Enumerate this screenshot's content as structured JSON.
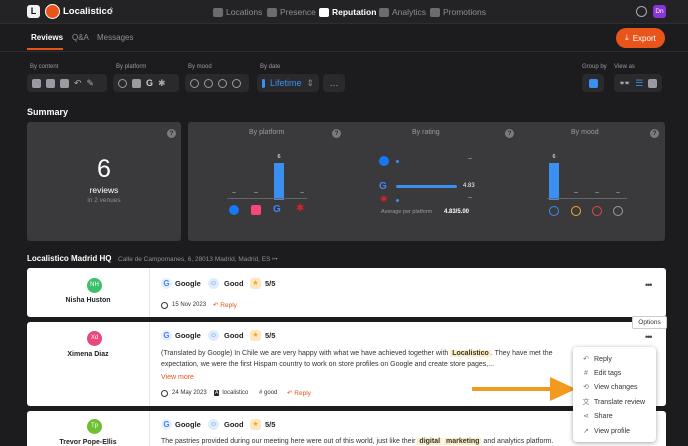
{
  "topbar": {
    "logo_letter": "L",
    "brand": "Localistico",
    "nav": [
      {
        "label": "Locations",
        "icon": "locations-icon"
      },
      {
        "label": "Presence",
        "icon": "presence-icon"
      },
      {
        "label": "Reputation",
        "icon": "reputation-icon"
      },
      {
        "label": "Analytics",
        "icon": "analytics-icon"
      },
      {
        "label": "Promotions",
        "icon": "promotions-icon"
      }
    ],
    "avatar": "Dn"
  },
  "tabs": [
    "Reviews",
    "Q&A",
    "Messages"
  ],
  "export_label": "Export",
  "filters": {
    "by_content": "By content",
    "by_platform": "By platform",
    "by_mood": "By mood",
    "by_date": "By date",
    "date_value": "Lifetime",
    "group_by": "Group by",
    "view_as": "View as"
  },
  "summary": {
    "title": "Summary",
    "count": "6",
    "count_label": "reviews",
    "venues": "in 2 venues",
    "by_platform": "By platform",
    "by_rating": "By rating",
    "by_mood": "By mood",
    "rating_avg_label": "Average per platform",
    "rating_avg_value": "4.83/5.00",
    "platform_bar_top": "6",
    "mood_bar_top": "6",
    "rating_value": "4.83"
  },
  "accent": "#e8541a",
  "venue": {
    "name": "Localistico Madrid HQ",
    "address": "Calle de Campomanes, 6, 28013 Madrid, Madrid, ES ↦"
  },
  "reviews": [
    {
      "initials": "NH",
      "name": "Nisha Huston",
      "avatar_color": "#3dbf6b",
      "platform": "Google",
      "mood": "Good",
      "rating": "5/5",
      "date": "15 Nov 2023",
      "reply": "Reply"
    },
    {
      "initials": "Xd",
      "name": "Ximena Diaz",
      "avatar_color": "#e8497a",
      "platform": "Google",
      "mood": "Good",
      "rating": "5/5",
      "text1": "(Translated by Google) In Chile we are very happy with what we have achieved together with",
      "hl1": "Localistico",
      "text1b": ". They have met the",
      "text2": "expectation, we were the first Hispam country to work on store profiles on Google and create store pages,...",
      "view_more": "View more",
      "date": "24 May 2023",
      "tag1": "localistico",
      "tag2": "good",
      "reply": "Reply"
    },
    {
      "initials": "Tp",
      "name": "Trevor Pope-Ellis",
      "avatar_color": "#6fbf34",
      "platform": "Google",
      "mood": "Good",
      "rating": "5/5",
      "text1": "The pastries provided during our meeting here were out of this world, just like their",
      "hl1": "digital",
      "hl2": "marketing",
      "text1b": "and analytics platform."
    }
  ],
  "tooltip": "Options",
  "menu": [
    "Reply",
    "Edit tags",
    "View changes",
    "Translate review",
    "Share",
    "View profile"
  ]
}
